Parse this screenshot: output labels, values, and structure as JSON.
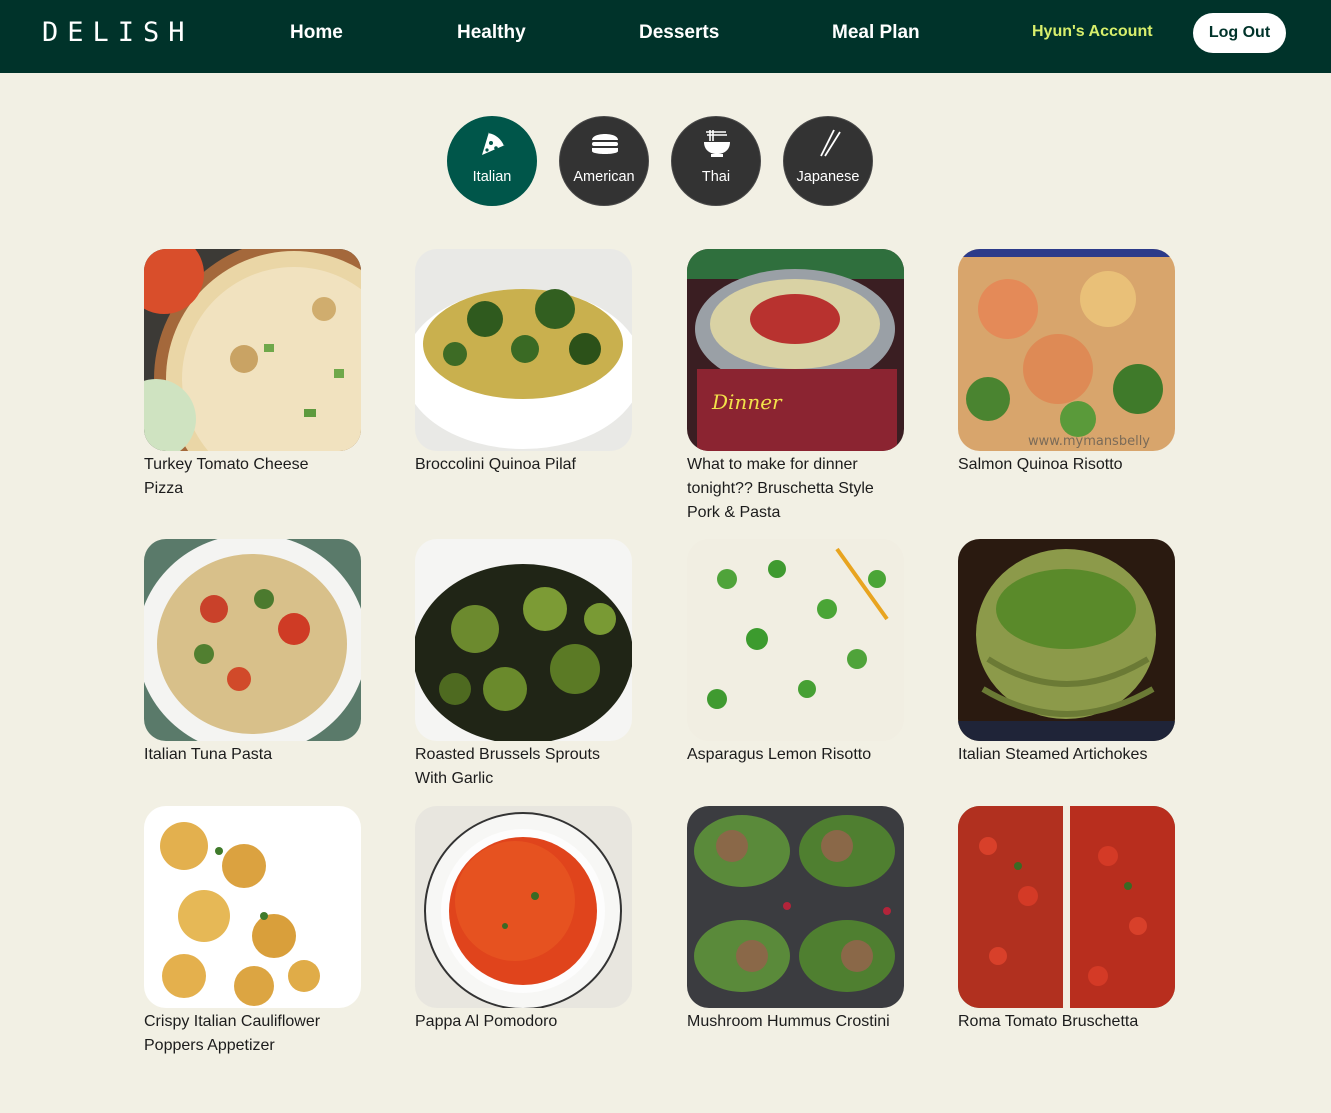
{
  "brand": "DELISH",
  "nav": {
    "home": "Home",
    "healthy": "Healthy",
    "desserts": "Desserts",
    "meal_plan": "Meal Plan"
  },
  "account": {
    "name": "Hyun's Account",
    "logout": "Log Out"
  },
  "cuisines": [
    {
      "label": "Italian",
      "icon": "pizza-icon",
      "active": true
    },
    {
      "label": "American",
      "icon": "burger-icon",
      "active": false
    },
    {
      "label": "Thai",
      "icon": "noodle-bowl-icon",
      "active": false
    },
    {
      "label": "Japanese",
      "icon": "chopsticks-icon",
      "active": false
    }
  ],
  "recipes": [
    {
      "title": "Turkey Tomato Cheese Pizza"
    },
    {
      "title": "Broccolini Quinoa Pilaf"
    },
    {
      "title": "What to make for dinner tonight?? Bruschetta Style Pork & Pasta"
    },
    {
      "title": "Salmon Quinoa Risotto"
    },
    {
      "title": "Italian Tuna Pasta"
    },
    {
      "title": "Roasted Brussels Sprouts With Garlic"
    },
    {
      "title": "Asparagus Lemon Risotto"
    },
    {
      "title": "Italian Steamed Artichokes"
    },
    {
      "title": "Crispy Italian Cauliflower Poppers Appetizer"
    },
    {
      "title": "Pappa Al Pomodoro"
    },
    {
      "title": "Mushroom Hummus Crostini"
    },
    {
      "title": "Roma Tomato Bruschetta"
    }
  ],
  "overlay_text": {
    "dinner_photo": "Dinner",
    "salmon_photo": "www.mymansbelly"
  },
  "colors": {
    "header_bg": "#00332a",
    "page_bg": "#f2f0e4",
    "active_cuisine": "#00564a",
    "inactive_cuisine": "#333333",
    "account_text": "#d8ef6c"
  }
}
